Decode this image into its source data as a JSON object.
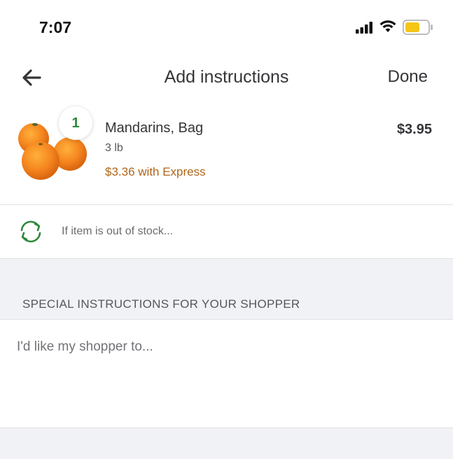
{
  "status_bar": {
    "time": "7:07"
  },
  "nav": {
    "title": "Add instructions",
    "done_label": "Done"
  },
  "item": {
    "quantity": "1",
    "name": "Mandarins, Bag",
    "size": "3 lb",
    "express_price": "$3.36 with Express",
    "price": "$3.95"
  },
  "out_of_stock": {
    "label": "If item is out of stock..."
  },
  "special_instructions": {
    "header": "SPECIAL INSTRUCTIONS FOR YOUR SHOPPER",
    "placeholder": "I'd like my shopper to...",
    "value": ""
  },
  "icons": {
    "back": "arrow-left-icon",
    "refresh": "refresh-icon",
    "signal": "cellular-signal-icon",
    "wifi": "wifi-icon",
    "battery": "battery-icon"
  },
  "colors": {
    "green": "#2e8a3b",
    "express_orange": "#b0661a",
    "battery_yellow": "#f5c518",
    "section_gray": "#f1f2f6"
  }
}
